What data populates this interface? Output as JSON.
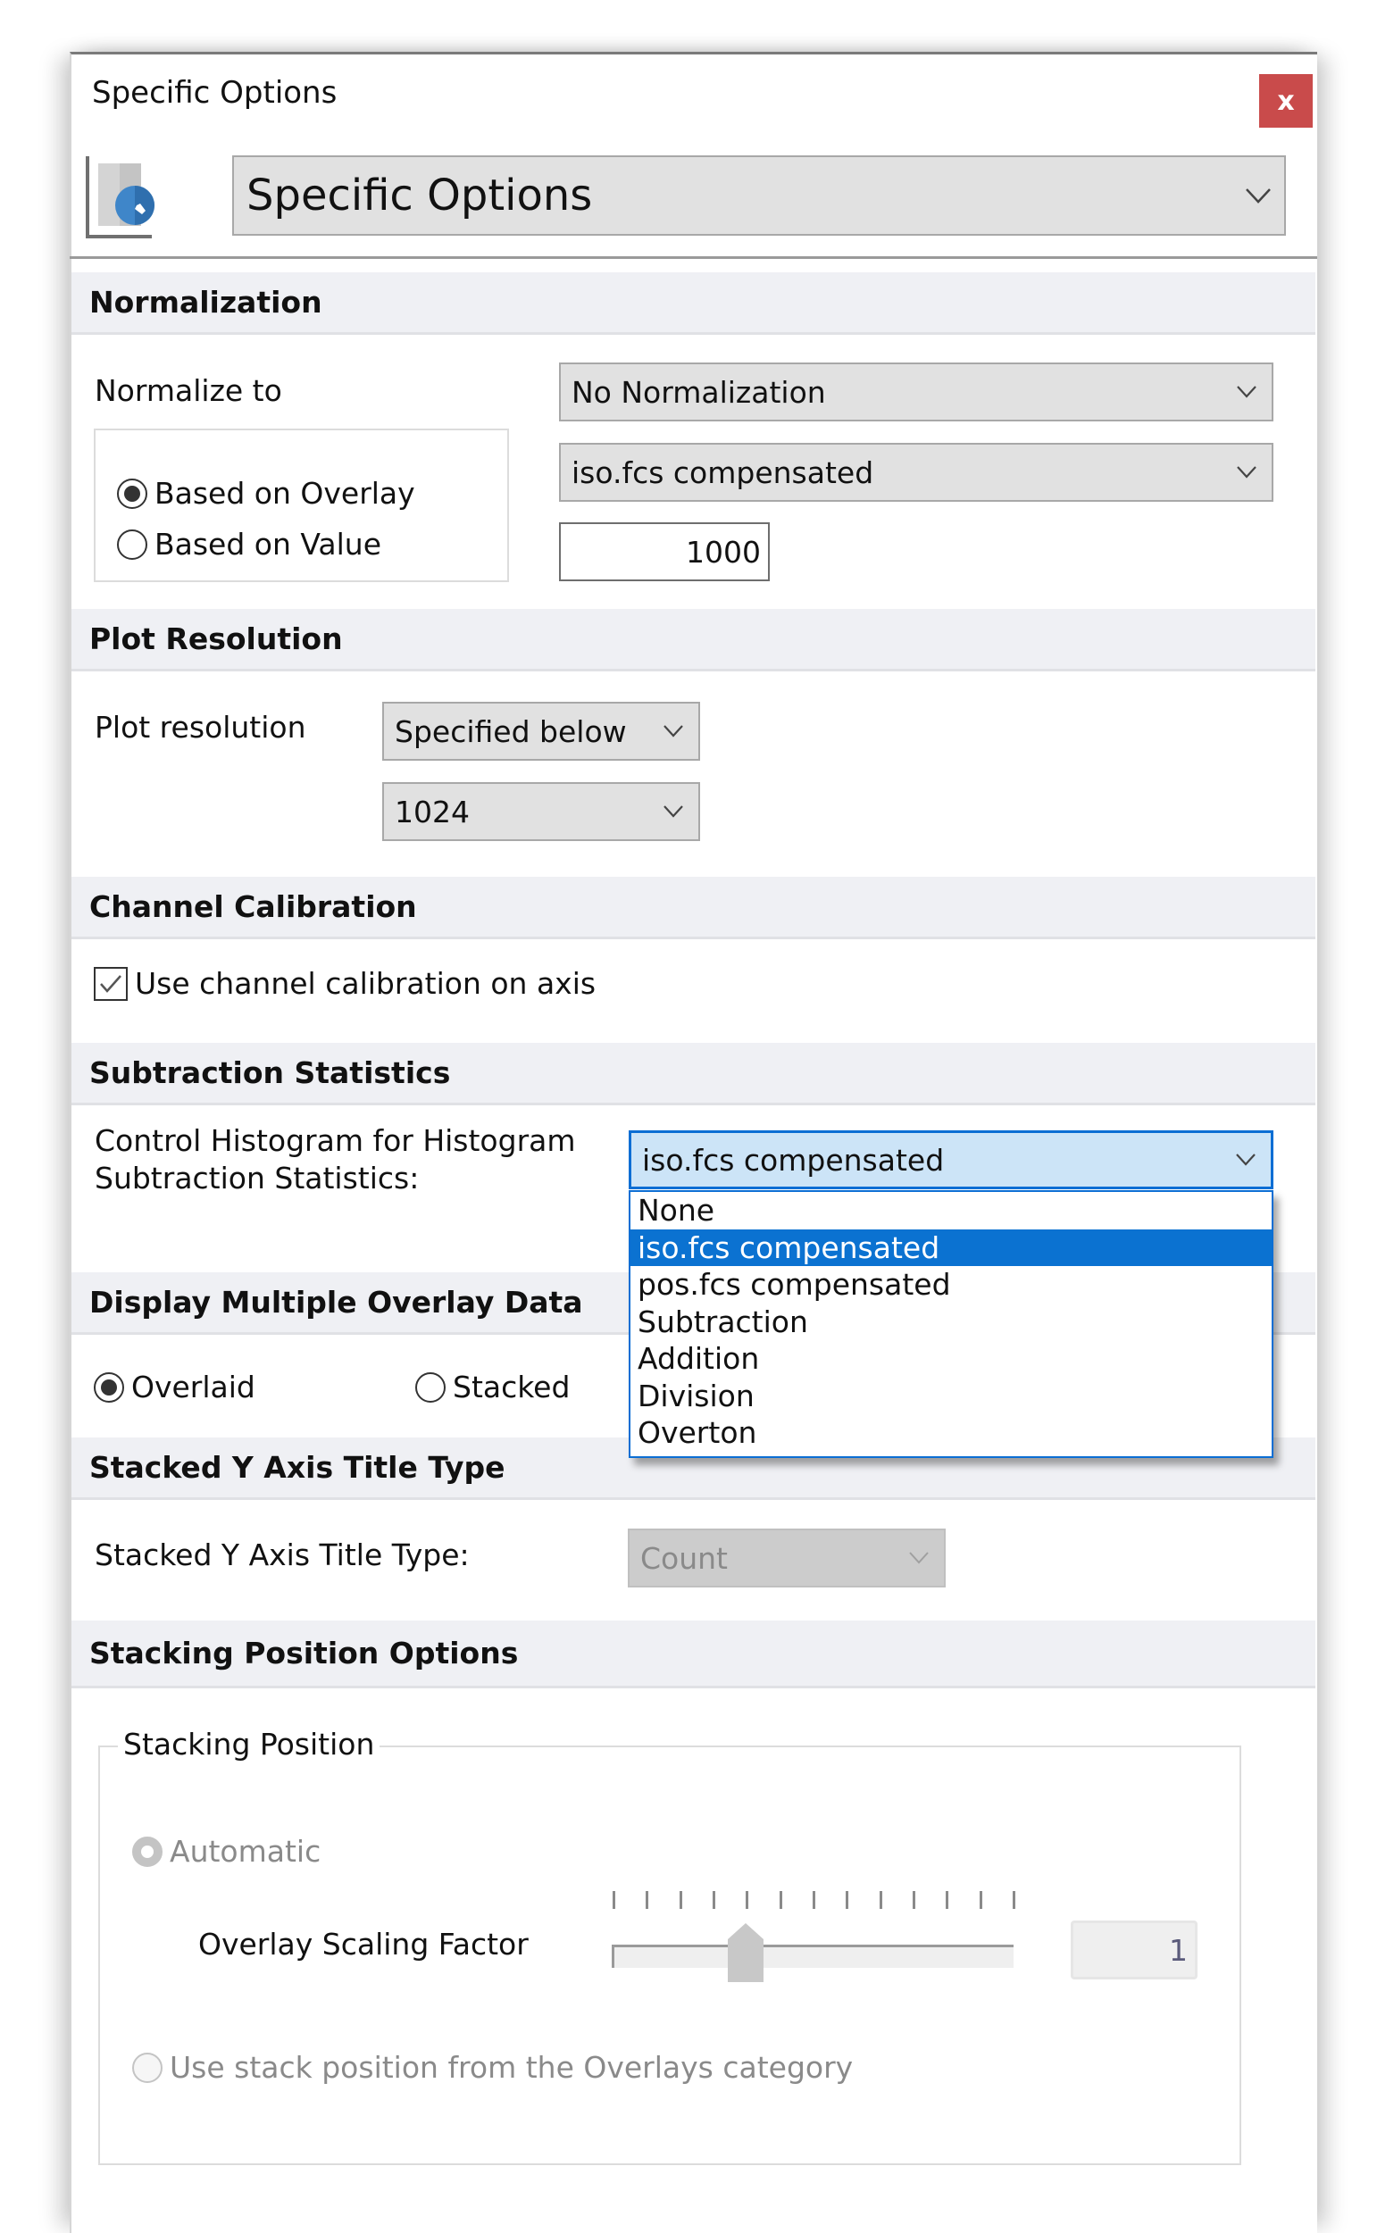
{
  "window": {
    "title": "Specific Options",
    "close_label": "x"
  },
  "category_selector": {
    "icon": "specific-options-wrench-icon",
    "value": "Specific Options"
  },
  "sections": {
    "normalization": {
      "header": "Normalization",
      "normalize_to_label": "Normalize to",
      "normalize_to_value": "No Normalization",
      "radio_options": [
        {
          "label": "Based on Overlay",
          "checked": true
        },
        {
          "label": "Based on Value",
          "checked": false
        }
      ],
      "overlay_value": "iso.fcs compensated",
      "value_input": "1000"
    },
    "plot_resolution": {
      "header": "Plot Resolution",
      "label": "Plot resolution",
      "mode_value": "Specified below",
      "resolution_value": "1024"
    },
    "channel_calibration": {
      "header": "Channel Calibration",
      "checkbox_label": "Use channel calibration on axis",
      "checked": true
    },
    "subtraction_statistics": {
      "header": "Subtraction Statistics",
      "label_line1": "Control Histogram for Histogram",
      "label_line2": "Subtraction Statistics:",
      "value": "iso.fcs compensated",
      "dropdown_open": true,
      "options": [
        "None",
        "iso.fcs compensated",
        "pos.fcs compensated",
        "Subtraction",
        "Addition",
        "Division",
        "Overton"
      ],
      "selected_index": 1
    },
    "display_multiple": {
      "header": "Display Multiple Overlay Data",
      "options": [
        {
          "label": "Overlaid",
          "checked": true
        },
        {
          "label": "Stacked",
          "checked": false
        }
      ]
    },
    "stacked_y_axis": {
      "header": "Stacked Y Axis Title Type",
      "label": "Stacked Y Axis Title Type:",
      "value": "Count",
      "enabled": false
    },
    "stacking_position": {
      "header": "Stacking Position Options",
      "group_title": "Stacking Position",
      "automatic_label": "Automatic",
      "scaling_label": "Overlay Scaling Factor",
      "slider_ticks": 13,
      "slider_fraction": 0.3333,
      "scaling_value": "1",
      "use_stack_label": "Use stack position from the Overlays category"
    }
  },
  "colors": {
    "close_button": "#c94b4b",
    "section_header_bg": "#eff0f4",
    "combo_bg": "#e1e1e1",
    "focus_blue": "#0b72d1",
    "focused_combo_bg": "#cce4f7"
  }
}
